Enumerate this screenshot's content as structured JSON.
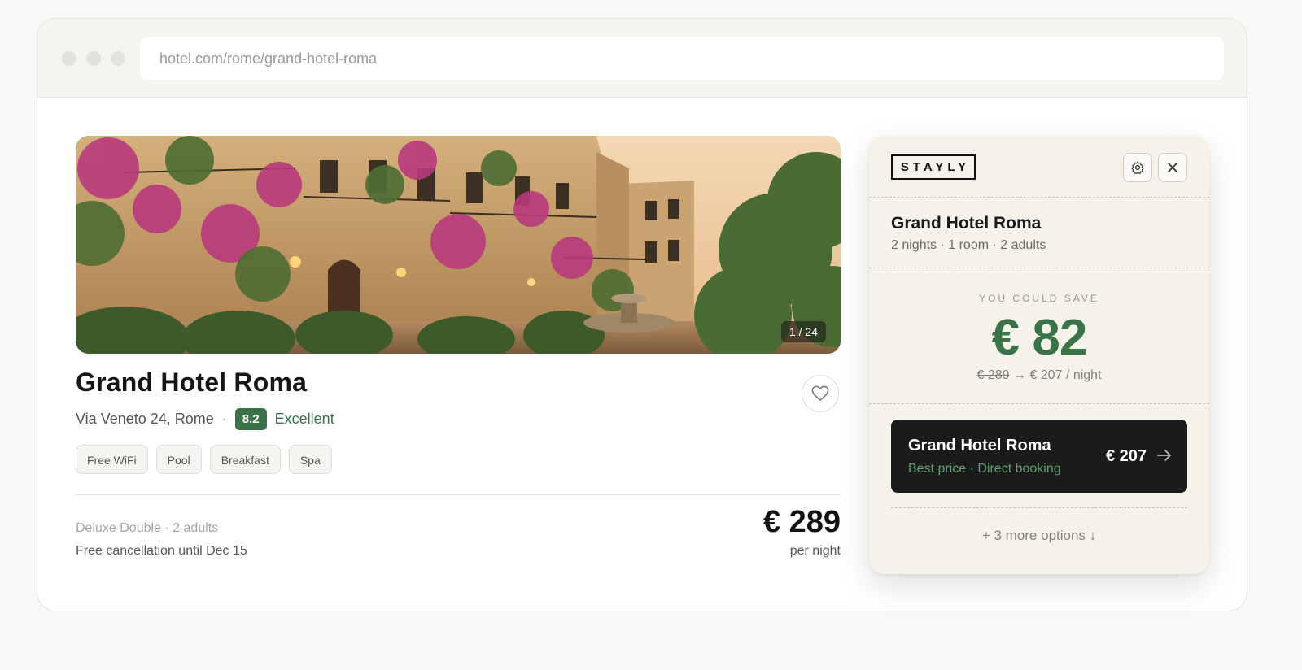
{
  "browser": {
    "url": "hotel.com/rome/grand-hotel-roma"
  },
  "hotel": {
    "name": "Grand Hotel Roma",
    "photo_counter": "1 / 24",
    "address": "Via Veneto 24, Rome",
    "separator": "·",
    "score": "8.2",
    "rating_label": "Excellent",
    "amenities": [
      "Free WiFi",
      "Pool",
      "Breakfast",
      "Spa"
    ],
    "room_type": "Deluxe Double · 2 adults",
    "cancellation": "Free cancellation until Dec 15",
    "price": "€ 289",
    "price_unit": "per night"
  },
  "extension": {
    "brand": "STAYLY",
    "hotel_name": "Grand Hotel Roma",
    "details": "2 nights · 1 room · 2 adults",
    "save_label": "YOU COULD SAVE",
    "save_amount": "€ 82",
    "old_price": "€ 289",
    "arrow": "→",
    "new_price": "€ 207 / night",
    "offer": {
      "name": "Grand Hotel Roma",
      "subtitle": "Best price · Direct booking",
      "price": "€ 207"
    },
    "more_options": "+ 3 more options ↓"
  },
  "icons": [
    "heart-icon",
    "gear-icon",
    "close-icon",
    "arrow-right-icon"
  ],
  "colors": {
    "accent_green": "#3b7348",
    "offer_green": "#5fa06c",
    "panel_bg": "#f5f2ea",
    "offer_bg": "#1b1b1b"
  }
}
